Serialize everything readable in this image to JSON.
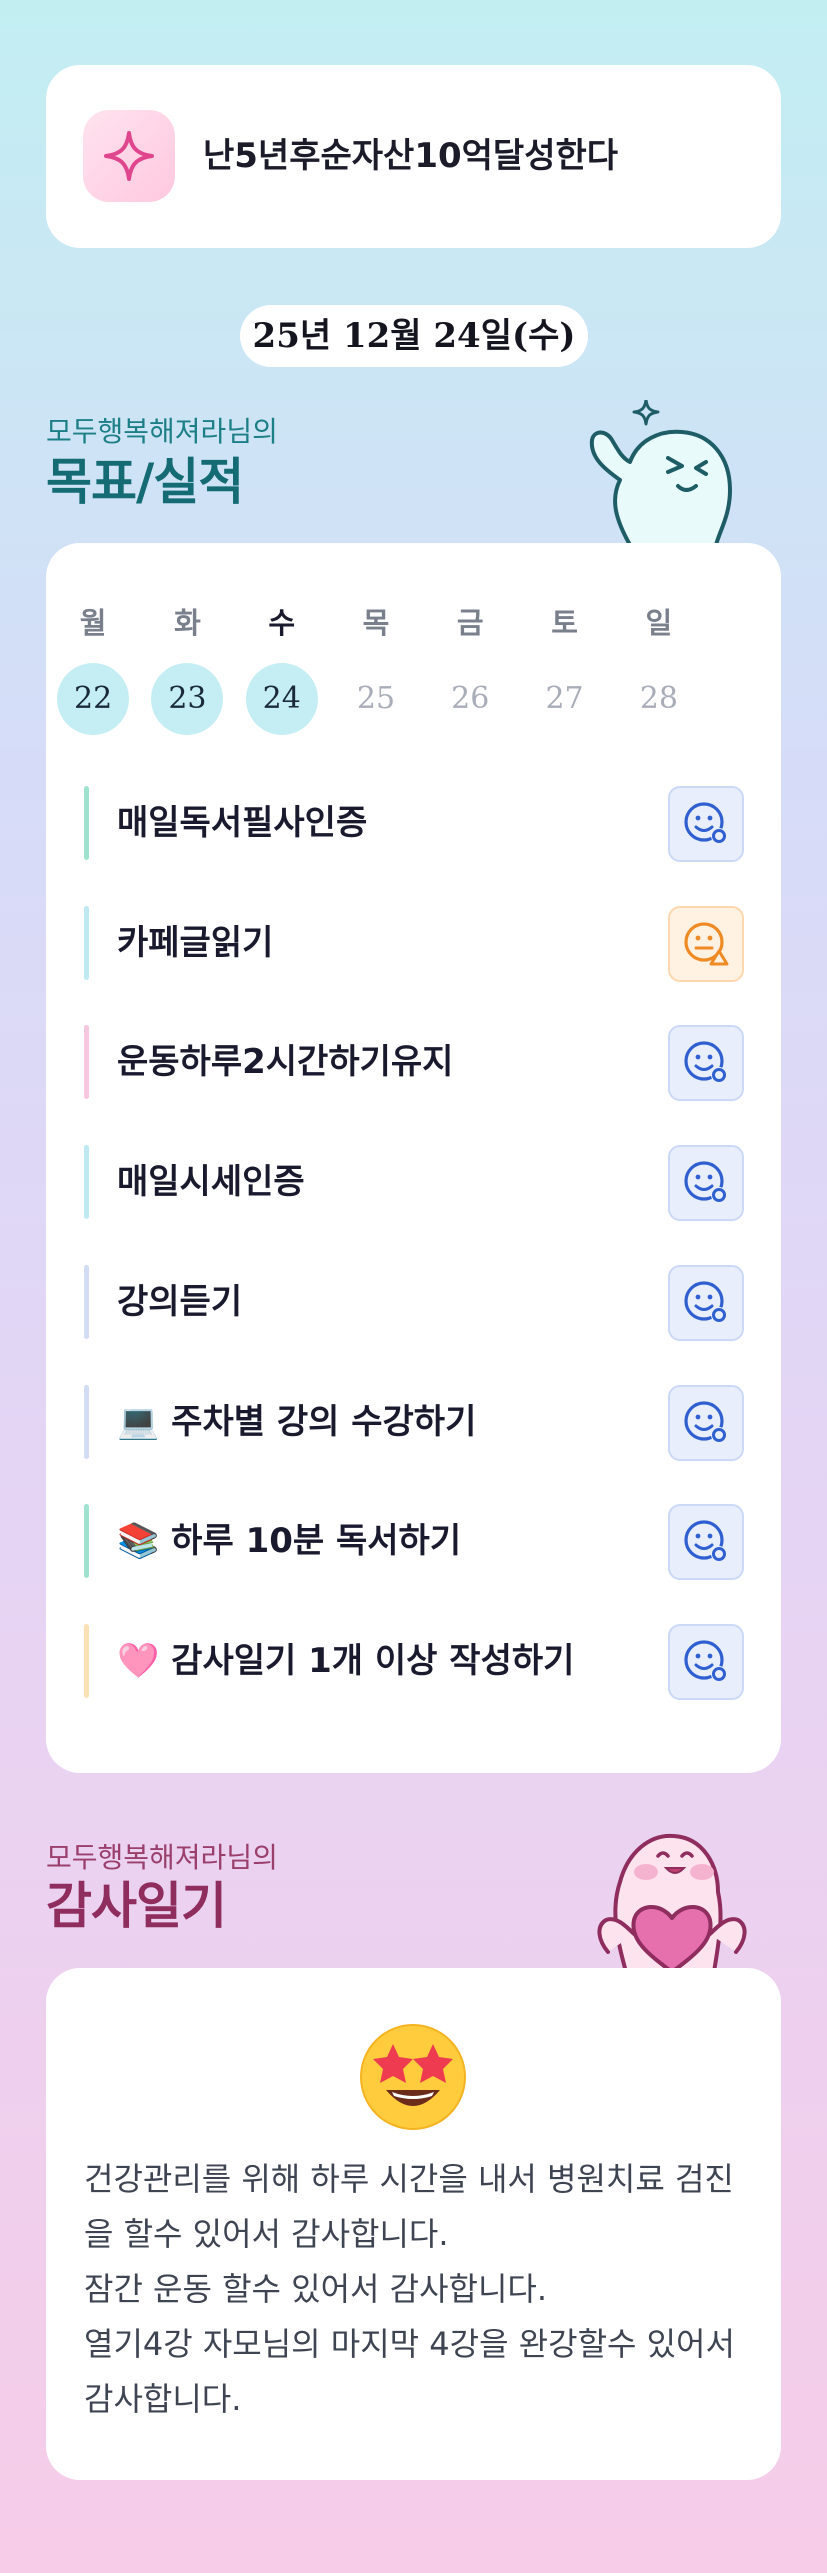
{
  "goal": {
    "title": "난5년후순자산10억달성한다",
    "icon": "sparkle-icon"
  },
  "date": "25년 12월 24일(수)",
  "goals_section": {
    "subtitle": "모두행복해져라님의",
    "title": "목표/실적"
  },
  "week": {
    "days": [
      "월",
      "화",
      "수",
      "목",
      "금",
      "토",
      "일"
    ],
    "dates": [
      "22",
      "23",
      "24",
      "25",
      "26",
      "27",
      "28"
    ],
    "completed": [
      true,
      true,
      true,
      false,
      false,
      false,
      false
    ],
    "today_index": 2
  },
  "goals": [
    {
      "label": "매일독서필사인증",
      "status": "good",
      "bar_color": "#9fe3cf"
    },
    {
      "label": "카페글읽기",
      "status": "warning",
      "bar_color": "#bfe9f3"
    },
    {
      "label": "운동하루2시간하기유지",
      "status": "good",
      "bar_color": "#f7c6df"
    },
    {
      "label": "매일시세인증",
      "status": "good",
      "bar_color": "#bfe9f3"
    },
    {
      "label": "강의듣기",
      "status": "good",
      "bar_color": "#d3dcf5"
    },
    {
      "label": "💻 주차별 강의 수강하기",
      "status": "good",
      "bar_color": "#d3dcf5"
    },
    {
      "label": "📚 하루 10분 독서하기",
      "status": "good",
      "bar_color": "#9fe3cf"
    },
    {
      "label": "🩷 감사일기 1개 이상 작성하기",
      "status": "good",
      "bar_color": "#fce0b6"
    }
  ],
  "gratitude_section": {
    "subtitle": "모두행복해져라님의",
    "title": "감사일기"
  },
  "gratitude": {
    "emoji": "star-struck-emoji",
    "lines": [
      "건강관리를 위해 하루 시간을 내서 병원치료 검진을 할수 있어서 감사합니다.",
      "잠간 운동 할수 있어서 감사합니다.",
      "열기4강 자모님의 마지막 4강을 완강할수 있어서 감사합니다."
    ]
  },
  "colors": {
    "accent_teal": "#156b74",
    "accent_pink": "#8e2d5e",
    "status_good": "#2f5fd0",
    "status_warn": "#f08a24",
    "today_circle": "#c4eef3"
  }
}
